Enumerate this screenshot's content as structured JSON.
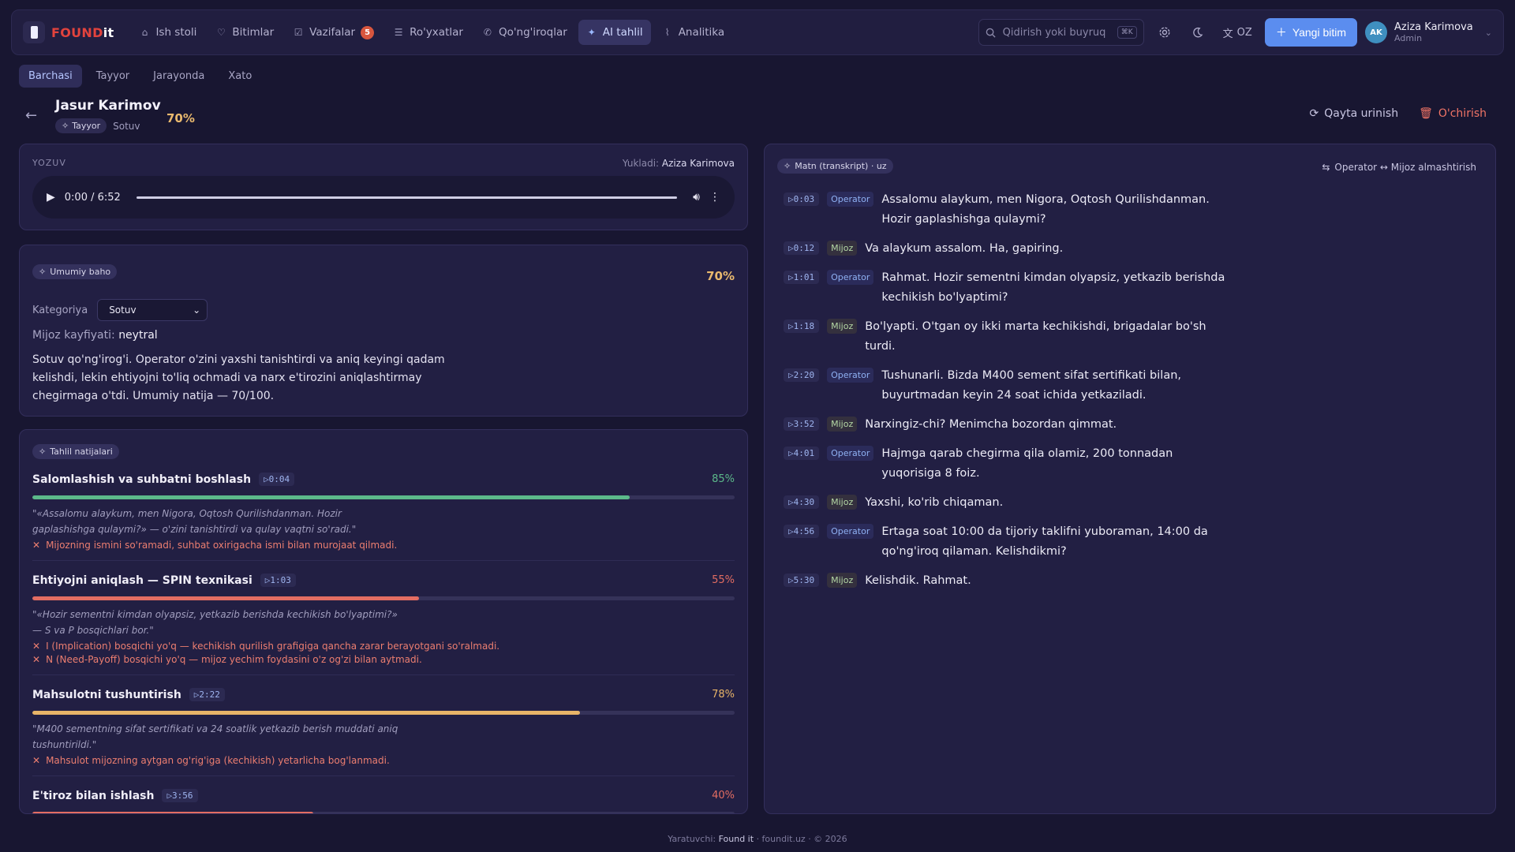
{
  "app": {
    "logo_found": "FOUND",
    "logo_it": "it"
  },
  "nav": {
    "items": [
      {
        "label": "Ish stoli",
        "icon": "dashboard-icon"
      },
      {
        "label": "Bitimlar",
        "icon": "handshake-icon"
      },
      {
        "label": "Vazifalar",
        "icon": "checkbox-icon",
        "badge": "5"
      },
      {
        "label": "Ro'yxatlar",
        "icon": "list-icon"
      },
      {
        "label": "Qo'ng'iroqlar",
        "icon": "phone-icon"
      },
      {
        "label": "AI tahlil",
        "icon": "sparkle-icon",
        "active": true
      },
      {
        "label": "Analitika",
        "icon": "chart-icon"
      }
    ],
    "search_placeholder": "Qidirish yoki buyruq",
    "search_shortcut": "⌘K",
    "lang": "OZ",
    "new_deal": "Yangi bitim",
    "user": {
      "initials": "AK",
      "name": "Aziza Karimova",
      "role": "Admin"
    }
  },
  "tabs": [
    "Barchasi",
    "Tayyor",
    "Jarayonda",
    "Xato"
  ],
  "active_tab": "Barchasi",
  "record": {
    "title": "Jasur Karimov",
    "status": "Tayyor",
    "category": "Sotuv",
    "score": "70%",
    "retry": "Qayta urinish",
    "delete": "O'chirish"
  },
  "audio": {
    "label": "YOZUV",
    "uploader_prefix": "Yukladi:",
    "uploader": "Aziza Karimova",
    "time": "0:00 / 6:52"
  },
  "summary": {
    "chip": "Umumiy baho",
    "score": "70%",
    "category_label": "Kategoriya",
    "category_value": "Sotuv",
    "mood_label": "Mijoz kayfiyati:",
    "mood_value": "neytral",
    "text": "Sotuv qo'ng'irog'i. Operator o'zini yaxshi tanishtirdi va aniq keyingi qadam kelishdi, lekin ehtiyojni to'liq ochmadi va narx e'tirozini aniqlashtirmay chegirmaga o'tdi. Umumiy natija — 70/100."
  },
  "analysis": {
    "chip": "Tahlil natijalari",
    "criteria": [
      {
        "title": "Salomlashish va suhbatni boshlash",
        "ts": "▷0:04",
        "pct": "85%",
        "value": 85,
        "color": "#5cb98a",
        "quote": "\"«Assalomu alaykum, men Nigora, Oqtosh Qurilishdanman. Hozir gaplashishga qulaymi?» — o'zini tanishtirdi va qulay vaqtni so'radi.\"",
        "issues": [
          "Mijozning ismini so'ramadi, suhbat oxirigacha ismi bilan murojaat qilmadi."
        ]
      },
      {
        "title": "Ehtiyojni aniqlash — SPIN texnikasi",
        "ts": "▷1:03",
        "pct": "55%",
        "value": 55,
        "color": "#e36d62",
        "quote": "\"«Hozir sementni kimdan olyapsiz, yetkazib berishda kechikish bo'lyaptimi?» — S va P bosqichlari bor.\"",
        "issues": [
          "I (Implication) bosqichi yo'q — kechikish qurilish grafigiga qancha zarar berayotgani so'ralmadi.",
          "N (Need-Payoff) bosqichi yo'q — mijoz yechim foydasini o'z og'zi bilan aytmadi."
        ]
      },
      {
        "title": "Mahsulotni tushuntirish",
        "ts": "▷2:22",
        "pct": "78%",
        "value": 78,
        "color": "#e8b468",
        "quote": "\"M400 sementning sifat sertifikati va 24 soatlik yetkazib berish muddati aniq tushuntirildi.\"",
        "issues": [
          "Mahsulot mijozning aytgan og'rig'iga (kechikish) yetarlicha bog'lanmadi."
        ]
      },
      {
        "title": "E'tiroz bilan ishlash",
        "ts": "▷3:56",
        "pct": "40%",
        "value": 40,
        "color": "#e36d62",
        "quote": "",
        "issues": []
      }
    ]
  },
  "transcript": {
    "chip": "Matn (transkript) · uz",
    "swap": "Operator ↔ Mijoz almashtirish",
    "lines": [
      {
        "ts": "▷0:03",
        "speaker": "Operator",
        "text": "Assalomu alaykum, men Nigora, Oqtosh Qurilishdanman. Hozir gaplashishga qulaymi?"
      },
      {
        "ts": "▷0:12",
        "speaker": "Mijoz",
        "text": "Va alaykum assalom. Ha, gapiring."
      },
      {
        "ts": "▷1:01",
        "speaker": "Operator",
        "text": "Rahmat. Hozir sementni kimdan olyapsiz, yetkazib berishda kechikish bo'lyaptimi?"
      },
      {
        "ts": "▷1:18",
        "speaker": "Mijoz",
        "text": "Bo'lyapti. O'tgan oy ikki marta kechikishdi, brigadalar bo'sh turdi."
      },
      {
        "ts": "▷2:20",
        "speaker": "Operator",
        "text": "Tushunarli. Bizda M400 sement sifat sertifikati bilan, buyurtmadan keyin 24 soat ichida yetkaziladi."
      },
      {
        "ts": "▷3:52",
        "speaker": "Mijoz",
        "text": "Narxingiz-chi? Menimcha bozordan qimmat."
      },
      {
        "ts": "▷4:01",
        "speaker": "Operator",
        "text": "Hajmga qarab chegirma qila olamiz, 200 tonnadan yuqorisiga 8 foiz."
      },
      {
        "ts": "▷4:30",
        "speaker": "Mijoz",
        "text": "Yaxshi, ko'rib chiqaman."
      },
      {
        "ts": "▷4:56",
        "speaker": "Operator",
        "text": "Ertaga soat 10:00 da tijoriy taklifni yuboraman, 14:00 da qo'ng'iroq qilaman. Kelishdikmi?"
      },
      {
        "ts": "▷5:30",
        "speaker": "Mijoz",
        "text": "Kelishdik. Rahmat."
      }
    ]
  },
  "footer": {
    "prefix": "Yaratuvchi:",
    "brand": "Found it",
    "rest": "· foundit.uz · © 2026"
  }
}
